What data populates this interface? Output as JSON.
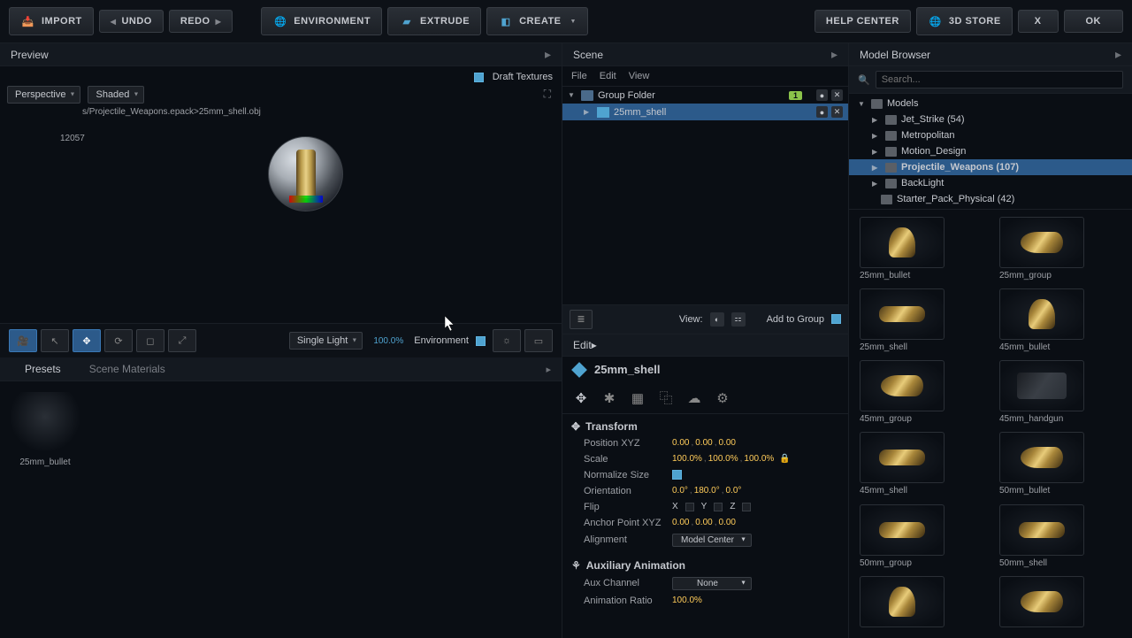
{
  "toolbar": {
    "import": "IMPORT",
    "undo": "UNDO",
    "redo": "REDO",
    "environment": "ENVIRONMENT",
    "extrude": "EXTRUDE",
    "create": "CREATE",
    "help": "HELP CENTER",
    "store": "3D STORE",
    "close": "X",
    "ok": "OK"
  },
  "preview": {
    "title": "Preview",
    "draft_textures": "Draft Textures",
    "proj_select": "Perspective",
    "shade_select": "Shaded",
    "path": "s/Projectile_Weapons.epack>25mm_shell.obj",
    "vertex_count": "12057",
    "vp_toolbar": {
      "light_select": "Single Light",
      "light_pct": "100.0%",
      "env_label": "Environment"
    }
  },
  "bottom_tabs": {
    "presets": "Presets",
    "materials": "Scene Materials",
    "material0": "25mm_bullet"
  },
  "scene": {
    "title": "Scene",
    "menu": {
      "file": "File",
      "edit": "Edit",
      "view": "View"
    },
    "tree": [
      {
        "name": "Group Folder",
        "badge": "1"
      },
      {
        "name": "25mm_shell"
      }
    ],
    "footer": {
      "view_label": "View:",
      "add_group": "Add to Group"
    }
  },
  "edit": {
    "title": "Edit",
    "object": "25mm_shell",
    "sections": {
      "transform": "Transform",
      "aux": "Auxiliary Animation"
    },
    "props": {
      "pos_label": "Position XYZ",
      "pos_x": "0.00",
      "pos_y": "0.00",
      "pos_z": "0.00",
      "scale_label": "Scale",
      "scale_x": "100.0%",
      "scale_y": "100.0%",
      "scale_z": "100.0%",
      "norm_label": "Normalize Size",
      "orient_label": "Orientation",
      "orient_x": "0.0°",
      "orient_y": "180.0°",
      "orient_z": "0.0°",
      "flip_label": "Flip",
      "anchor_label": "Anchor Point XYZ",
      "anchor_x": "0.00",
      "anchor_y": "0.00",
      "anchor_z": "0.00",
      "align_label": "Alignment",
      "align_val": "Model Center",
      "aux_channel_label": "Aux Channel",
      "aux_channel_val": "None",
      "anim_ratio_label": "Animation Ratio",
      "anim_ratio_val": "100.0%"
    }
  },
  "browser": {
    "title": "Model Browser",
    "search_placeholder": "Search...",
    "tree": [
      {
        "name": "Models",
        "indent": 0,
        "expanded": true
      },
      {
        "name": "Jet_Strike (54)",
        "indent": 1
      },
      {
        "name": "Metropolitan",
        "indent": 1
      },
      {
        "name": "Motion_Design",
        "indent": 1
      },
      {
        "name": "Projectile_Weapons (107)",
        "indent": 1,
        "selected": true
      },
      {
        "name": "BackLight",
        "indent": 1
      },
      {
        "name": "Starter_Pack_Physical (42)",
        "indent": 1
      }
    ],
    "assets": [
      "25mm_bullet",
      "25mm_group",
      "25mm_shell",
      "45mm_bullet",
      "45mm_group",
      "45mm_handgun",
      "45mm_shell",
      "50mm_bullet",
      "50mm_group",
      "50mm_shell",
      "",
      ""
    ]
  }
}
